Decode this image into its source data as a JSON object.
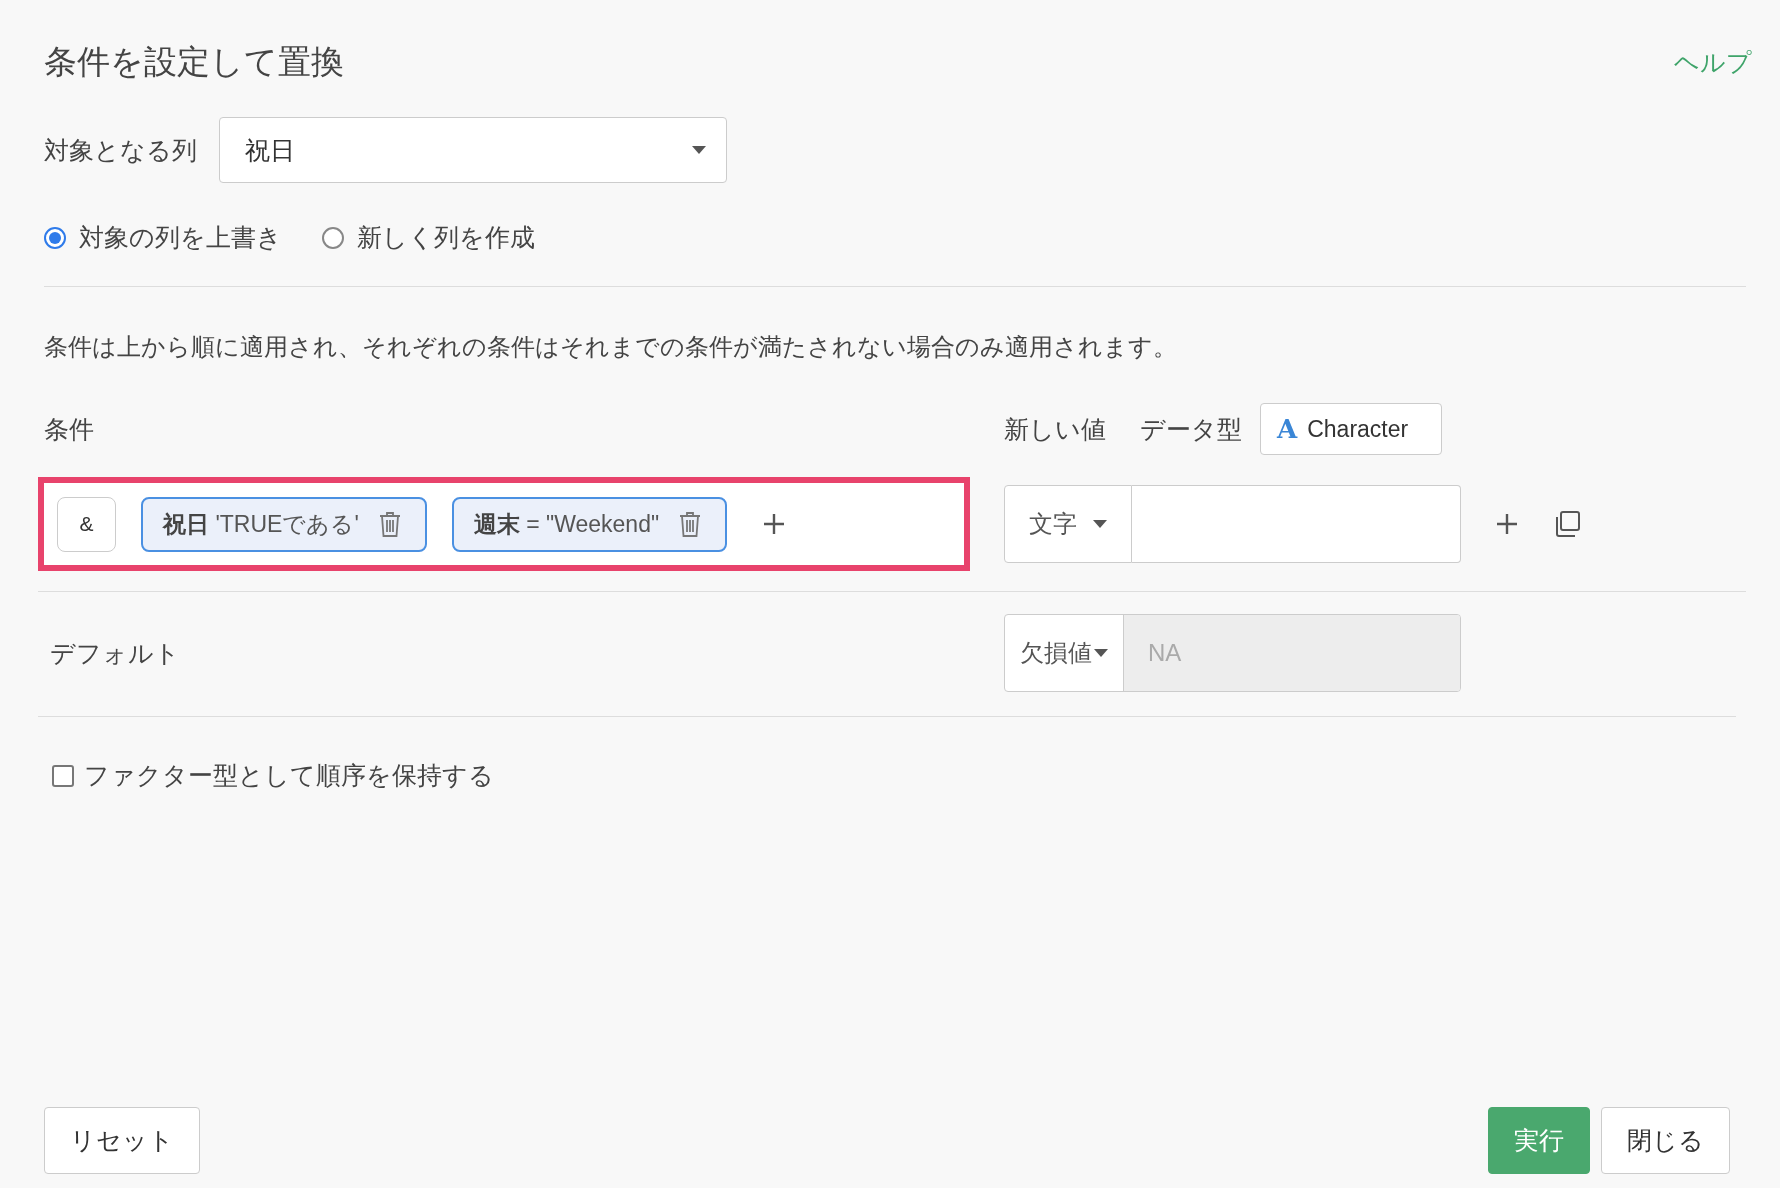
{
  "title": "条件を設定して置換",
  "help_link": "ヘルプ",
  "target_column": {
    "label": "対象となる列",
    "value": "祝日"
  },
  "output_options": [
    {
      "label": "対象の列を上書き",
      "selected": true
    },
    {
      "label": "新しく列を作成",
      "selected": false
    }
  ],
  "description": "条件は上から順に適用され、それぞれの条件はそれまでの条件が満たされない場合のみ適用されます。",
  "conditions_header": {
    "label": "条件",
    "new_value_label": "新しい値",
    "data_type_label": "データ型",
    "data_type": {
      "icon": "A",
      "label": "Character"
    }
  },
  "condition_rows": [
    {
      "operator": "&",
      "highlighted": true,
      "filters": [
        {
          "column": "祝日",
          "expression": "'TRUEである'"
        },
        {
          "column": "週末",
          "expression": "= \"Weekend\""
        }
      ],
      "value_type": "文字"
    }
  ],
  "default": {
    "label": "デフォルト",
    "value_type": "欠損値",
    "placeholder": "NA",
    "disabled": true
  },
  "factor_option": {
    "label": "ファクター型として順序を保持する",
    "checked": false
  },
  "buttons": [
    {
      "label": "リセット",
      "kind": "secondary"
    },
    {
      "label": "実行",
      "kind": "primary"
    },
    {
      "label": "閉じる",
      "kind": "secondary"
    }
  ]
}
